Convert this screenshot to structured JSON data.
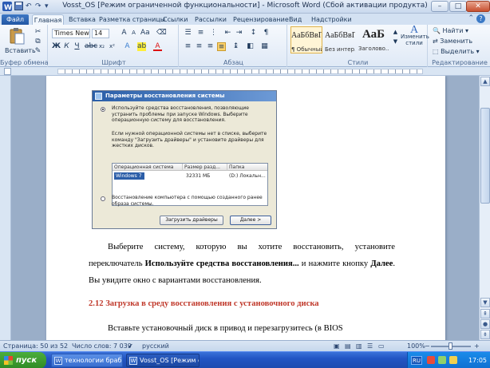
{
  "window": {
    "title": "Vosst_OS [Режим ограниченной функциональности] - Microsoft Word (Сбой активации продукта)",
    "buttons": {
      "minimize": "–",
      "maximize": "□",
      "close": "✕"
    }
  },
  "tabs": [
    "Файл",
    "Главная",
    "Вставка",
    "Разметка страницы",
    "Ссылки",
    "Рассылки",
    "Рецензирование",
    "Вид",
    "Надстройки"
  ],
  "ribbon": {
    "clipboard": {
      "paste": "Вставить",
      "label": "Буфер обмена"
    },
    "font": {
      "name": "Times New Ro",
      "size": "14",
      "label": "Шрифт"
    },
    "paragraph": {
      "label": "Абзац"
    },
    "styles": {
      "items": [
        {
          "sample": "АаБбВвГг,",
          "name": "¶ Обычный"
        },
        {
          "sample": "АаБбВвГг,",
          "name": "Без интер..."
        },
        {
          "sample": "АаБ",
          "name": "Заголово..."
        }
      ],
      "change": "Изменить стили",
      "label": "Стили"
    },
    "editing": {
      "find": "Найти",
      "replace": "Заменить",
      "select": "Выделить",
      "label": "Редактирование"
    }
  },
  "dialog": {
    "title": "Параметры восстановления системы",
    "option1": "Используйте средства восстановления, позволяющие устранить проблемы при запуске Windows. Выберите операционную систему для восстановления.",
    "note": "Если нужной операционной системы нет в списке, выберите команду \"Загрузить драйверы\" и установите драйверы для жестких дисков.",
    "columns": [
      "Операционная система",
      "Размер разд...",
      "Папка"
    ],
    "row": [
      "Windows 7",
      "32331 МБ",
      "(D:) Локальн..."
    ],
    "option2": "Восстановление компьютера с помощью созданного ранее образа системы.",
    "load_drivers": "Загрузить драйверы",
    "next": "Далее >"
  },
  "document": {
    "para1_a": "Выберите систему, которую вы хотите восстановить, установите переключатель ",
    "para1_b": "Используйте средства восстановления...",
    "para1_c": " и нажмите кнопку ",
    "para1_d": "Далее",
    "para1_e": ". Вы увидите окно с вариантами восстановления.",
    "heading": "2.12 Загрузка в среду восстановления с установочного диска",
    "para2": "Вставьте установочный диск в привод и перезагрузитесь (в BIOS"
  },
  "status": {
    "page": "Страница: 50 из 52",
    "words": "Число слов: 7 039",
    "lang": "русский",
    "zoom": "100%"
  },
  "taskbar": {
    "start": "пуск",
    "tasks": [
      "технологии браб...",
      "Vosst_OS [Режим о..."
    ],
    "lang": "RU",
    "clock": "17:05"
  }
}
